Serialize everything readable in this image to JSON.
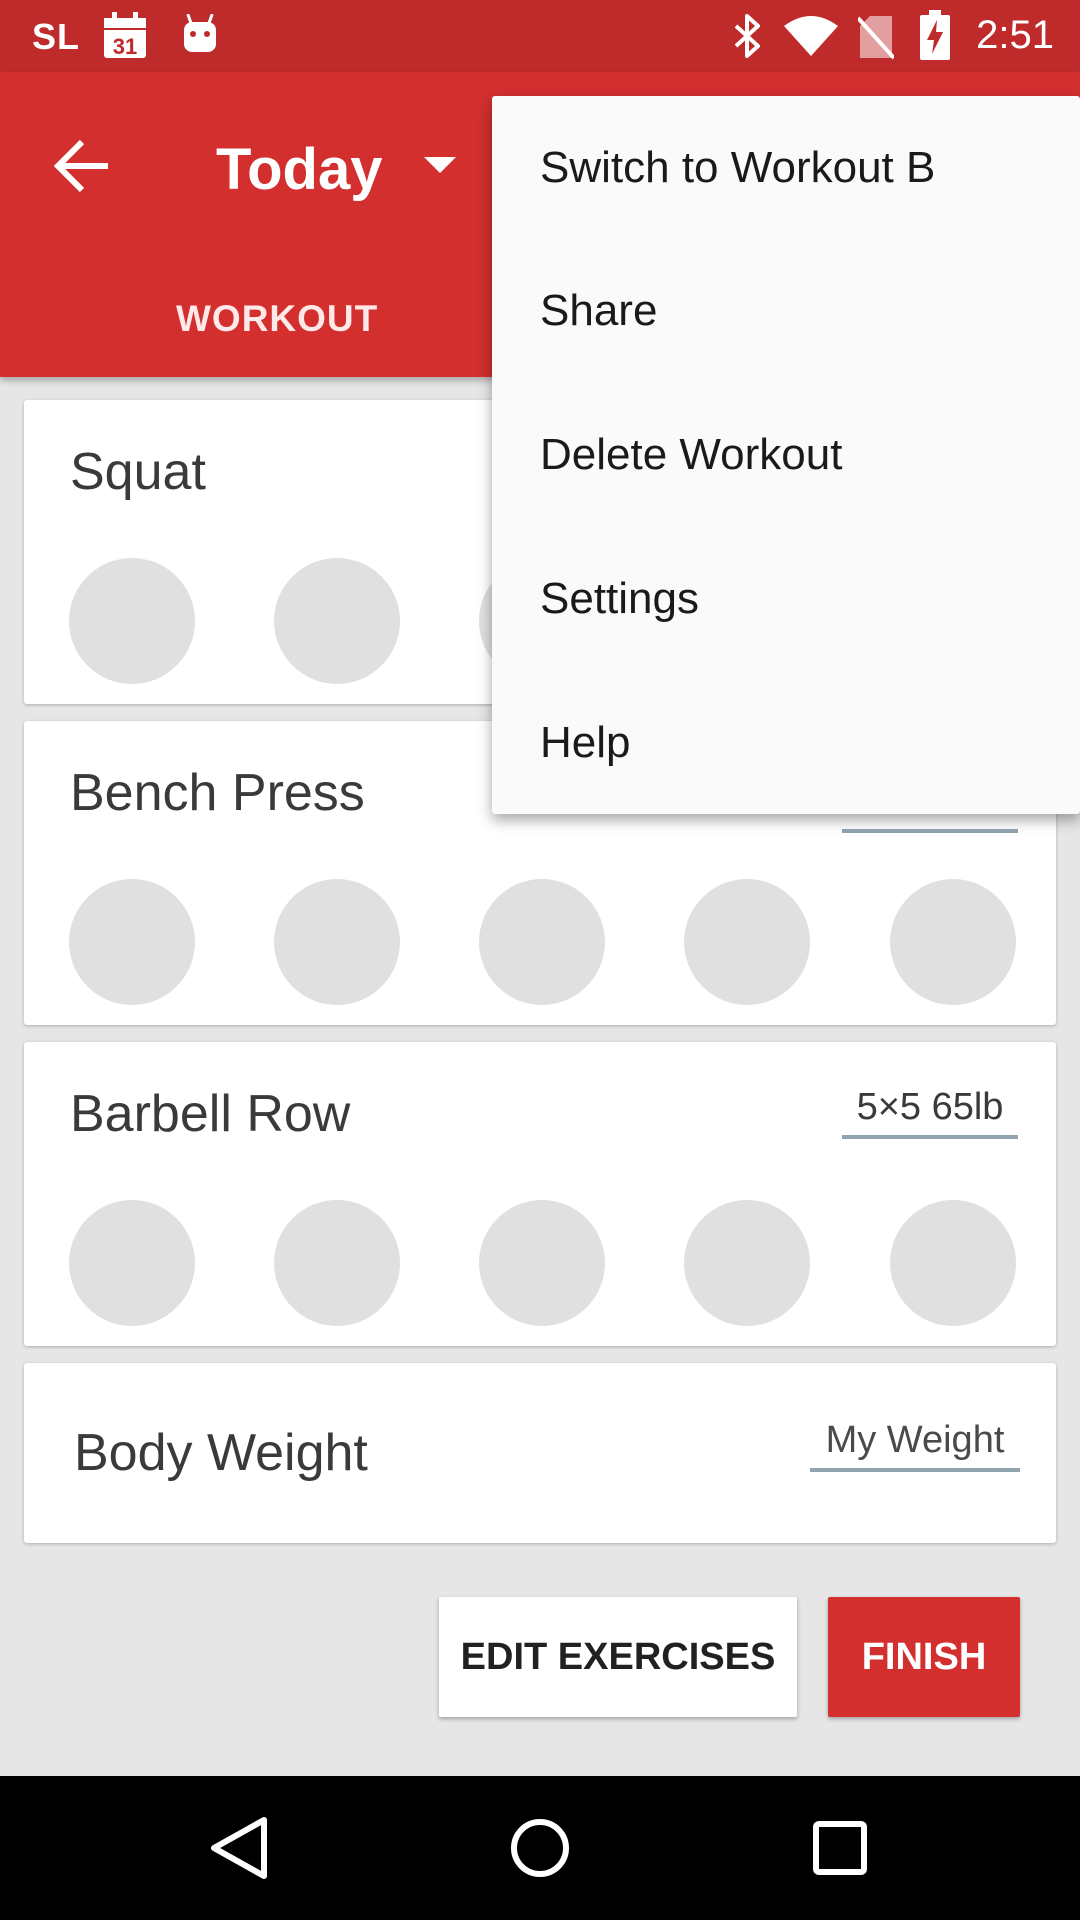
{
  "status_bar": {
    "left_text": "SL",
    "calendar_day": "31",
    "time": "2:51"
  },
  "app_bar": {
    "title": "Today",
    "tab_workout": "WORKOUT"
  },
  "exercises": [
    {
      "name": "Squat",
      "reps_label": "",
      "sets": 5
    },
    {
      "name": "Bench Press",
      "reps_label": "",
      "sets": 5
    },
    {
      "name": "Barbell Row",
      "reps_label": "5×5 65lb",
      "sets": 5
    }
  ],
  "body_weight": {
    "label": "Body Weight",
    "placeholder": "My Weight"
  },
  "buttons": {
    "edit_exercises": "EDIT EXERCISES",
    "finish": "FINISH"
  },
  "menu": {
    "items": [
      "Switch to Workout B",
      "Share",
      "Delete Workout",
      "Settings",
      "Help"
    ]
  },
  "colors": {
    "status_bar": "#bf2a2a",
    "app_bar": "#d32f2f",
    "set_circle": "#e0e0e0",
    "underline": "#90a4ae"
  },
  "icons": {
    "back": "arrow-left-icon",
    "dropdown": "caret-down-icon",
    "calendar": "calendar-icon",
    "android": "android-icon",
    "bluetooth": "bluetooth-icon",
    "wifi": "wifi-icon",
    "no_sim": "no-sim-icon",
    "battery": "battery-charging-icon",
    "nav_back": "nav-back-icon",
    "nav_home": "nav-home-icon",
    "nav_recents": "nav-recents-icon"
  }
}
